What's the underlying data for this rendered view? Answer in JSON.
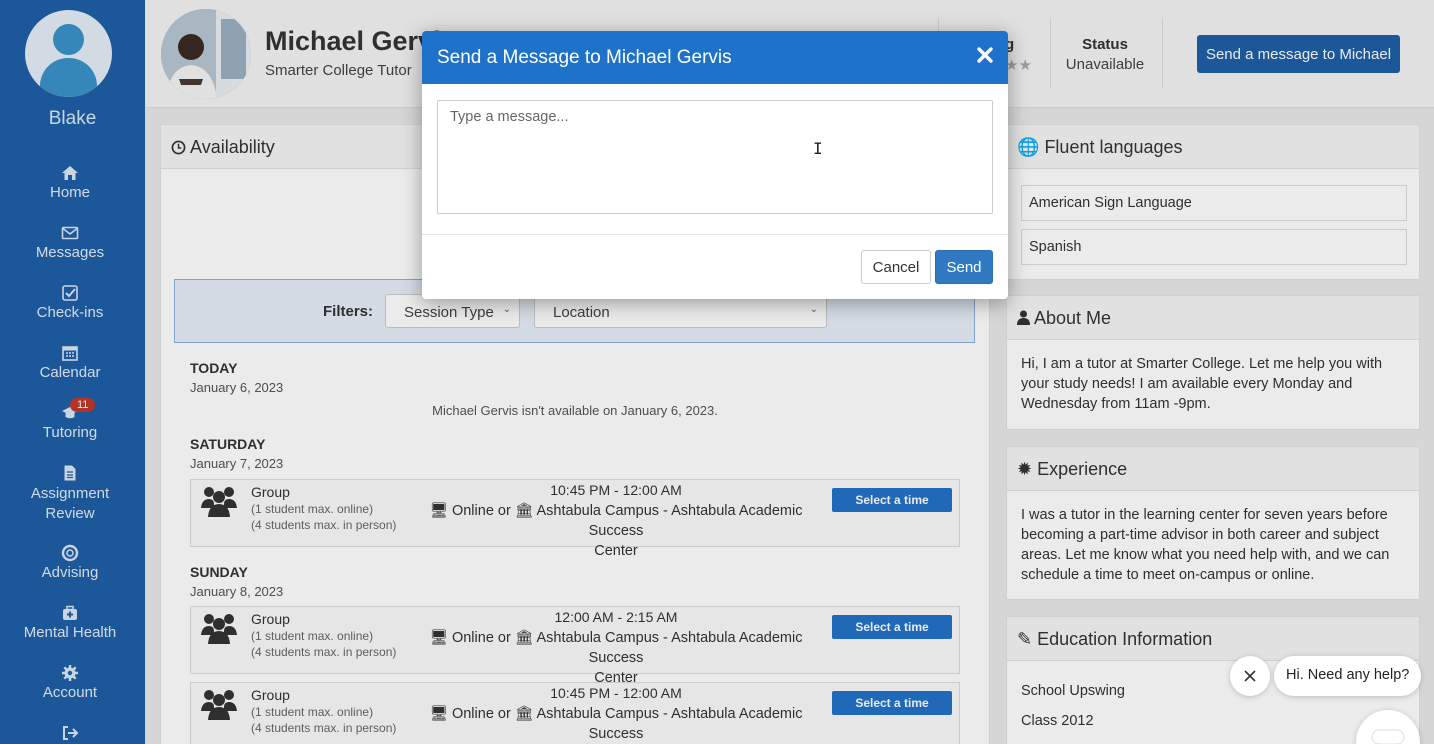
{
  "sidebar": {
    "user_name": "Blake",
    "items": [
      {
        "label": "Home",
        "icon": "home-icon"
      },
      {
        "label": "Messages",
        "icon": "envelope-icon"
      },
      {
        "label": "Check-ins",
        "icon": "check-square-icon"
      },
      {
        "label": "Calendar",
        "icon": "calendar-icon"
      },
      {
        "label": "Tutoring",
        "icon": "graduation-cap-icon",
        "badge": "11"
      },
      {
        "label": "Assignment Review",
        "icon": "document-icon"
      },
      {
        "label": "Advising",
        "icon": "life-ring-icon"
      },
      {
        "label": "Mental Health",
        "icon": "medkit-icon"
      },
      {
        "label": "Account",
        "icon": "gear-icon"
      },
      {
        "label": "",
        "icon": "sign-out-icon"
      }
    ]
  },
  "header": {
    "name": "Michael Gervis",
    "role": "Smarter College Tutor",
    "rating_fragment": "g",
    "status_label": "Status",
    "status_value": "Unavailable",
    "message_button": "Send a message to Michael"
  },
  "availability": {
    "title": "Availability",
    "filters_label": "Filters:",
    "session_type": "Session Type",
    "location": "Location",
    "days": [
      {
        "title": "TODAY",
        "date": "January 6, 2023",
        "note": "Michael Gervis isn't available on January 6, 2023."
      },
      {
        "title": "SATURDAY",
        "date": "January 7, 2023",
        "slots": [
          {
            "type": "Group",
            "online_max": "(1 student max. online)",
            "person_max": "(4 students max. in person)",
            "time": "10:45 PM - 12:00 AM",
            "location": "Online or Ashtabula Campus - Ashtabula Academic Success Center",
            "button": "Select a time"
          }
        ]
      },
      {
        "title": "SUNDAY",
        "date": "January 8, 2023",
        "slots": [
          {
            "type": "Group",
            "online_max": "(1 student max. online)",
            "person_max": "(4 students max. in person)",
            "time": "12:00 AM - 2:15 AM",
            "location": "Online or Ashtabula Campus - Ashtabula Academic Success Center",
            "button": "Select a time"
          },
          {
            "type": "Group",
            "online_max": "(1 student max. online)",
            "person_max": "(4 students max. in person)",
            "time": "10:45 PM - 12:00 AM",
            "location": "Online or Ashtabula Campus - Ashtabula Academic Success Center",
            "button": "Select a time"
          }
        ]
      }
    ],
    "online_word": "Online or",
    "campus_text": "Ashtabula Campus - Ashtabula Academic Success",
    "campus_text_2": "Center"
  },
  "languages": {
    "title": "Fluent languages",
    "items": [
      "American Sign Language",
      "Spanish"
    ]
  },
  "about": {
    "title": "About Me",
    "text": "Hi, I am a tutor at Smarter College. Let me help you with your study needs! I am available every Monday and Wednesday from 11am -9pm."
  },
  "experience": {
    "title": "Experience",
    "text": "I was a tutor in the learning center for seven years before becoming a part-time advisor in both career and subject areas. Let me know what you need help with, and we can schedule a time to meet on-campus or online."
  },
  "education": {
    "title": "Education Information",
    "school_label": "School",
    "school_value": "Upswing",
    "class_label": "Class",
    "class_value": "2012"
  },
  "modal": {
    "title": "Send a Message to Michael Gervis",
    "placeholder": "Type a message...",
    "value": "",
    "cancel": "Cancel",
    "send": "Send"
  },
  "chat": {
    "bubble": "Hi. Need any help?"
  },
  "colors": {
    "sidebar": "#1f5fa8",
    "modal_header": "#1f72c9",
    "primary_button": "#2f7ac3",
    "badge": "#c0392b"
  }
}
